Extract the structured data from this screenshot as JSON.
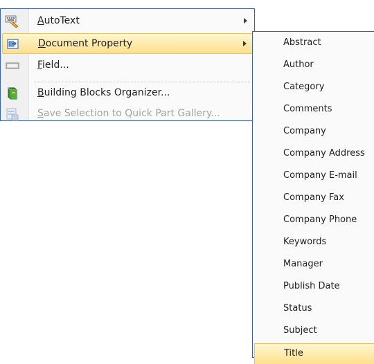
{
  "menu": {
    "items": [
      {
        "label": "AutoText",
        "accel": "A",
        "rest": "utoText",
        "icon": "autotext-icon",
        "state": "normal",
        "submenu": true
      },
      {
        "label": "Document Property",
        "accel": "D",
        "rest": "ocument Property",
        "icon": "document-property-icon",
        "state": "highlighted",
        "submenu": true
      },
      {
        "label": "Field...",
        "accel": "F",
        "rest": "ield...",
        "icon": "field-icon",
        "state": "normal",
        "submenu": false
      },
      {
        "label": "Building Blocks Organizer...",
        "accel": "B",
        "rest": "uilding Blocks Organizer...",
        "icon": "building-blocks-icon",
        "state": "normal",
        "submenu": false
      },
      {
        "label": "Save Selection to Quick Part Gallery...",
        "accel": "S",
        "rest": "ave Selection to Quick Part Gallery...",
        "icon": "save-selection-icon",
        "state": "disabled",
        "submenu": false
      }
    ]
  },
  "submenu": {
    "items": [
      "Abstract",
      "Author",
      "Category",
      "Comments",
      "Company",
      "Company Address",
      "Company E-mail",
      "Company Fax",
      "Company Phone",
      "Keywords",
      "Manager",
      "Publish Date",
      "Status",
      "Subject",
      "Title"
    ],
    "highlighted": "Title"
  },
  "colors": {
    "border": "#3b63a3",
    "highlight_top": "#fff6d3",
    "highlight_bottom": "#ffe08a",
    "disabled_text": "#a2a2a2"
  }
}
